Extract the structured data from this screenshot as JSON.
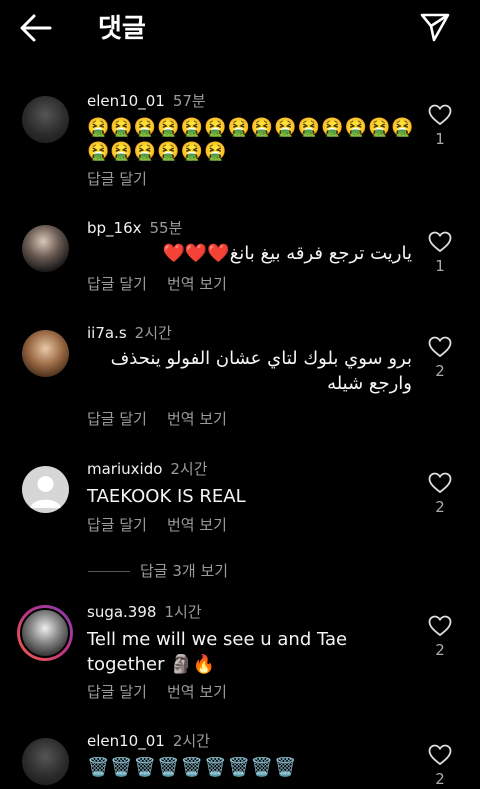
{
  "header": {
    "title": "댓글",
    "back_icon": "arrow-left-icon",
    "send_icon": "paper-plane-icon"
  },
  "actions": {
    "reply_label": "답글 달기",
    "translate_label": "번역 보기"
  },
  "comments": [
    {
      "username": "elen10_01",
      "time": "57분",
      "text": "🤮🤮🤮🤮🤮🤮🤮🤮🤮🤮🤮🤮🤮🤮🤮🤮🤮🤮🤮🤮",
      "likes": "1",
      "show_translate": false
    },
    {
      "username": "bp_16x",
      "time": "55분",
      "text": "ياريت ترجع فرقه بيغ بانغ❤️❤️❤️",
      "likes": "1",
      "show_translate": true
    },
    {
      "username": "ii7a.s",
      "time": "2시간",
      "text": "برو سوي بلوك لتاي عشان الفولو ينحذف وارجع شيله",
      "likes": "2",
      "show_translate": true
    },
    {
      "username": "mariuxido",
      "time": "2시간",
      "text": "TAEKOOK IS REAL",
      "likes": "2",
      "show_translate": true
    },
    {
      "username": "suga.398",
      "time": "1시간",
      "text": "Tell me will we see u and Tae together 🗿🔥",
      "likes": "2",
      "show_translate": true
    },
    {
      "username": "elen10_01",
      "time": "2시간",
      "text": "🗑️🗑️🗑️🗑️🗑️🗑️🗑️🗑️🗑️",
      "likes": "2",
      "show_translate": false
    }
  ],
  "view_replies": "답글 3개 보기",
  "colors": {
    "background": "#000000",
    "text": "#f5f5f5",
    "secondary": "#9a9a9a",
    "story_ring_start": "#c13584",
    "story_ring_end": "#f56040"
  }
}
